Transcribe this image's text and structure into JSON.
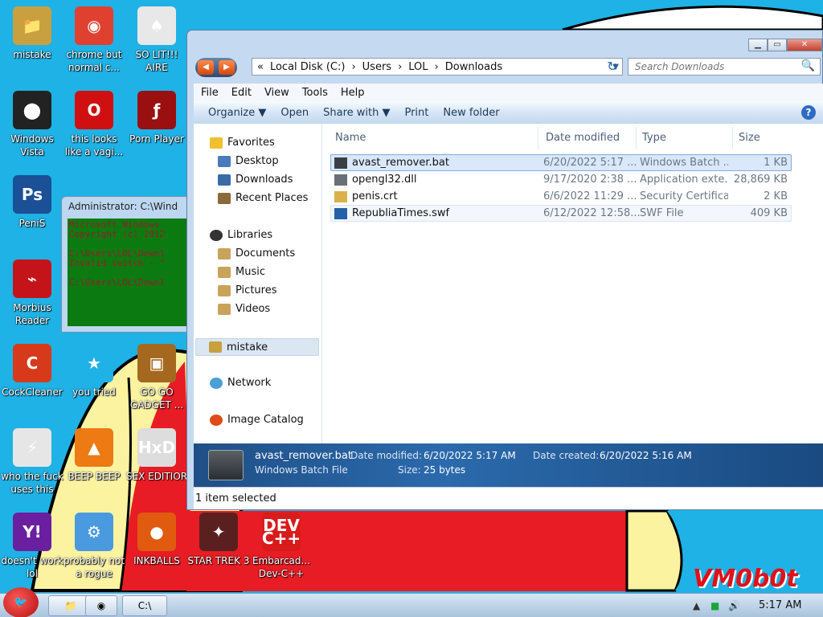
{
  "desktop": {
    "icons": [
      {
        "label": "mistake",
        "glyph": "📁",
        "color": "#c8a040"
      },
      {
        "label": "chrome but normal c...",
        "glyph": "◉",
        "color": "#e04030"
      },
      {
        "label": "SO LIT!!! AIRE",
        "glyph": "♠",
        "color": "#e8e8e8"
      },
      {
        "label": "Windows Vista",
        "glyph": "⬤",
        "color": "#222222"
      },
      {
        "label": "this looks like a vagi...",
        "glyph": "O",
        "color": "#d01010"
      },
      {
        "label": "Porn Player",
        "glyph": "ƒ",
        "color": "#9a0f0f"
      },
      {
        "label": "PeniS",
        "glyph": "Ps",
        "color": "#1b4f96"
      },
      {
        "label": "Morbius Reader",
        "glyph": "⌁",
        "color": "#c4141a"
      },
      {
        "label": "CockCleaner",
        "glyph": "C",
        "color": "#d63a1a"
      },
      {
        "label": "you tried",
        "glyph": "★",
        "color": "#1fb2e6"
      },
      {
        "label": "GO GO GADGET ...",
        "glyph": "▣",
        "color": "#a5681f"
      },
      {
        "label": "who the fuck uses this",
        "glyph": "⚡",
        "color": "#e6e6e6"
      },
      {
        "label": "BEEP BEEP",
        "glyph": "▲",
        "color": "#ee7a14"
      },
      {
        "label": "SEX EDITIOR",
        "glyph": "HxD",
        "color": "#dddddd"
      },
      {
        "label": "doesn't work lol",
        "glyph": "Y!",
        "color": "#6a1fa0"
      },
      {
        "label": "probably not a rogue",
        "glyph": "⚙",
        "color": "#4a9ae0"
      },
      {
        "label": "INKBALLS",
        "glyph": "●",
        "color": "#e05a10"
      },
      {
        "label": "STAR TREK 3",
        "glyph": "✦",
        "color": "#5a2020"
      },
      {
        "label": "Embarcad... Dev-C++",
        "glyph": "DEV C++",
        "color": "#d81b1b"
      }
    ],
    "watermark": "VM0b0t"
  },
  "cmd": {
    "title": "Administrator: C:\\Wind",
    "body": "Microsoft Windows\nCopyright (c) 2012\n\nC:\\Users\\LOL\\Downl\nInvalid switch - \"\n\nC:\\Users\\LOL\\Downl"
  },
  "explorer": {
    "caption": {
      "minimize": "▁",
      "maximize": "▭",
      "close": "✕"
    },
    "nav": {
      "back": "◀",
      "forward": "▶"
    },
    "address": {
      "prefix": "«",
      "segments": [
        "Local Disk (C:)",
        "Users",
        "LOL",
        "Downloads"
      ],
      "sep": "›",
      "dropdown": "▼"
    },
    "refresh": "↻",
    "search": {
      "placeholder": "Search Downloads",
      "icon": "🔍"
    },
    "menu": [
      "File",
      "Edit",
      "View",
      "Tools",
      "Help"
    ],
    "commands": [
      "Organize ▼",
      "Open",
      "Share with ▼",
      "Print",
      "New folder"
    ],
    "help": "?",
    "nav_pane": {
      "favorites": "Favorites",
      "favorites_items": [
        "Desktop",
        "Downloads",
        "Recent Places"
      ],
      "libraries": "Libraries",
      "libraries_items": [
        "Documents",
        "Music",
        "Pictures",
        "Videos"
      ],
      "homegroup": "mistake",
      "network": "Network",
      "catalog": "Image Catalog"
    },
    "columns": {
      "name": "Name",
      "date": "Date modified",
      "type": "Type",
      "size": "Size"
    },
    "files": [
      {
        "name": "avast_remover.bat",
        "date": "6/20/2022 5:17 ...",
        "type": "Windows Batch ...",
        "size": "1 KB",
        "color": "#3a3f45"
      },
      {
        "name": "opengl32.dll",
        "date": "9/17/2020 2:38 ...",
        "type": "Application exte...",
        "size": "28,869 KB",
        "color": "#6b6f76"
      },
      {
        "name": "penis.crt",
        "date": "6/6/2022 11:29 ...",
        "type": "Security Certifica...",
        "size": "2 KB",
        "color": "#d9b04a"
      },
      {
        "name": "RepubliaTimes.swf",
        "date": "6/12/2022 12:58...",
        "type": "SWF File",
        "size": "409 KB",
        "color": "#2461a8"
      }
    ],
    "details": {
      "name": "avast_remover.bat",
      "type": "Windows Batch File",
      "modified_label": "Date modified:",
      "modified": "6/20/2022 5:17 AM",
      "size_label": "Size:",
      "size": "25 bytes",
      "created_label": "Date created:",
      "created": "6/20/2022 5:16 AM"
    },
    "status": "1 item selected"
  },
  "taskbar": {
    "start": "🐦",
    "buttons": [
      "📁",
      "◉",
      "C:\\"
    ],
    "tray": [
      "▲",
      "■",
      "🔊"
    ],
    "clock": "5:17 AM"
  }
}
